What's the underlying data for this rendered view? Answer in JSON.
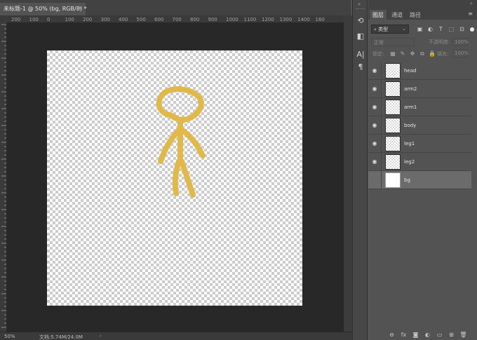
{
  "document": {
    "tab_title": "未标题-1 @ 50% (bg, RGB/8) *",
    "close_glyph": "×"
  },
  "ruler": {
    "horizontal_ticks": [
      "200",
      "100",
      "0",
      "100",
      "200",
      "300",
      "400",
      "500",
      "600",
      "700",
      "800",
      "900",
      "1000",
      "1100",
      "1200",
      "1300",
      "1400",
      "160"
    ]
  },
  "canvas": {
    "stroke_color": "#e1b94a",
    "content": "stick-figure"
  },
  "statusbar": {
    "zoom": "50%",
    "doc_info": "文档:5.74M/24.0M",
    "arrow": "›"
  },
  "toolstrip": {
    "collapse_glyph": "«",
    "tools": [
      {
        "name": "history-icon",
        "glyph": "⟲"
      },
      {
        "name": "adjust-icon",
        "glyph": "◧"
      },
      {
        "name": "character-icon",
        "glyph": "A|"
      },
      {
        "name": "paragraph-icon",
        "glyph": "¶"
      }
    ]
  },
  "panel": {
    "collapse_glyph": "»",
    "tabs": [
      {
        "label": "图层",
        "active": true
      },
      {
        "label": "通道",
        "active": false
      },
      {
        "label": "路径",
        "active": false
      }
    ],
    "menu_glyph": "≡",
    "filter": {
      "label": "类型",
      "search_glyph": "⌕",
      "caret": "⌄"
    },
    "blend_mode": "正常",
    "opacity_label": "不透明度:",
    "opacity_value": "100%",
    "lock_label": "锁定:",
    "fill_label": "填充:",
    "fill_value": "100%",
    "layers": [
      {
        "name": "head",
        "visible": true,
        "selected": false,
        "thumb": "transparent"
      },
      {
        "name": "arm2",
        "visible": true,
        "selected": false,
        "thumb": "transparent"
      },
      {
        "name": "arm1",
        "visible": true,
        "selected": false,
        "thumb": "transparent"
      },
      {
        "name": "body",
        "visible": true,
        "selected": false,
        "thumb": "transparent"
      },
      {
        "name": "leg1",
        "visible": true,
        "selected": false,
        "thumb": "transparent"
      },
      {
        "name": "leg2",
        "visible": true,
        "selected": false,
        "thumb": "transparent"
      },
      {
        "name": "bg",
        "visible": false,
        "selected": true,
        "thumb": "white"
      }
    ],
    "bottom_icons": [
      {
        "name": "link-layers-icon",
        "glyph": "⊖"
      },
      {
        "name": "layer-style-icon",
        "glyph": "fx"
      },
      {
        "name": "add-mask-icon",
        "glyph": "◙"
      },
      {
        "name": "adjustment-layer-icon",
        "glyph": "◐"
      },
      {
        "name": "new-group-icon",
        "glyph": "▭"
      },
      {
        "name": "new-layer-icon",
        "glyph": "⊞"
      },
      {
        "name": "delete-layer-icon",
        "glyph": "🗑"
      }
    ]
  }
}
